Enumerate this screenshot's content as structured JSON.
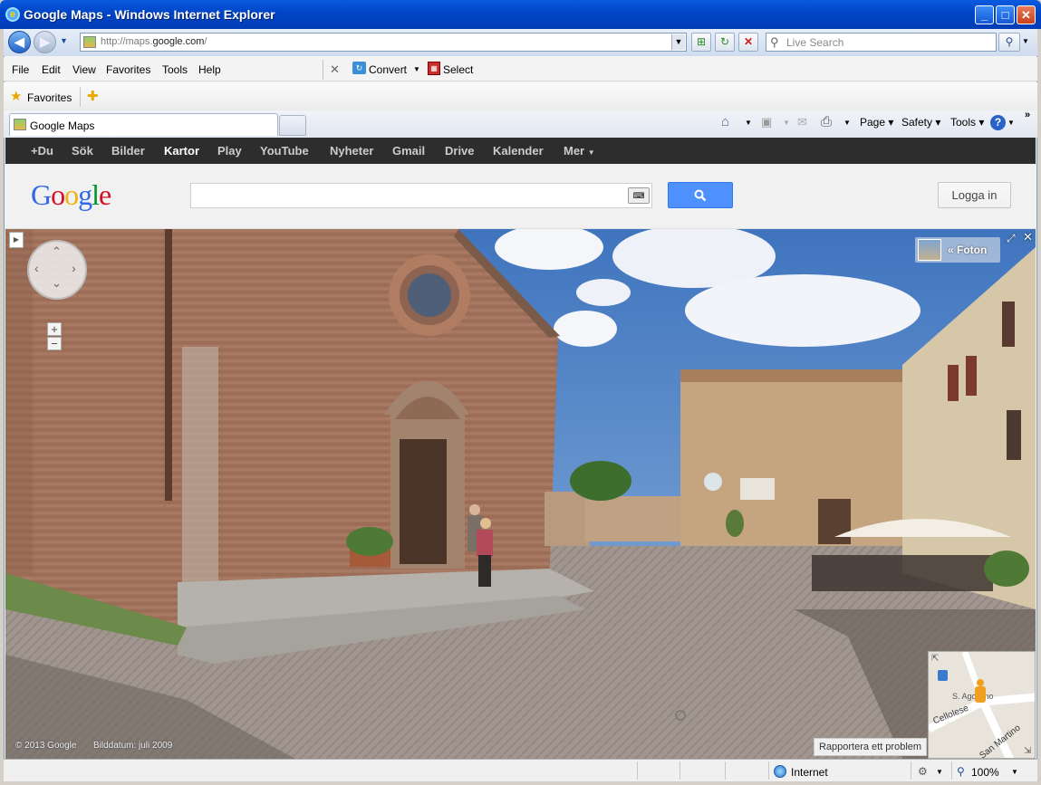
{
  "window": {
    "title": "Google Maps - Windows Internet Explorer"
  },
  "address": {
    "url_prefix": "http://maps.",
    "url_domain": "google.com",
    "url_suffix": "/"
  },
  "search": {
    "placeholder": "Live Search"
  },
  "menu": [
    "File",
    "Edit",
    "View",
    "Favorites",
    "Tools",
    "Help"
  ],
  "toolbar": {
    "convert_label": "Convert",
    "select_label": "Select"
  },
  "favorites": {
    "label": "Favorites"
  },
  "tab": {
    "title": "Google Maps"
  },
  "commands": {
    "page": "Page",
    "safety": "Safety",
    "tools": "Tools"
  },
  "google_bar": {
    "items": [
      "+Du",
      "Sök",
      "Bilder",
      "Kartor",
      "Play",
      "YouTube",
      "Nyheter",
      "Gmail",
      "Drive",
      "Kalender",
      "Mer"
    ],
    "active": "Kartor"
  },
  "google": {
    "logo": "Google",
    "login": "Logga in"
  },
  "streetview": {
    "photos_label": "« Foton",
    "copyright": "© 2013 Google",
    "date": "Bilddatum: juli 2009",
    "report": "Rapportera ett problem",
    "minimap": {
      "street1": "Cellolese",
      "street2": "San Martino",
      "place": "S. Agostino"
    }
  },
  "status": {
    "zone": "Internet",
    "zoom": "100%"
  },
  "colors": {
    "titlebar": "#0046c8",
    "gbar": "#2d2d2d",
    "search_button": "#4d90fe",
    "sky": "#4f82c4"
  }
}
